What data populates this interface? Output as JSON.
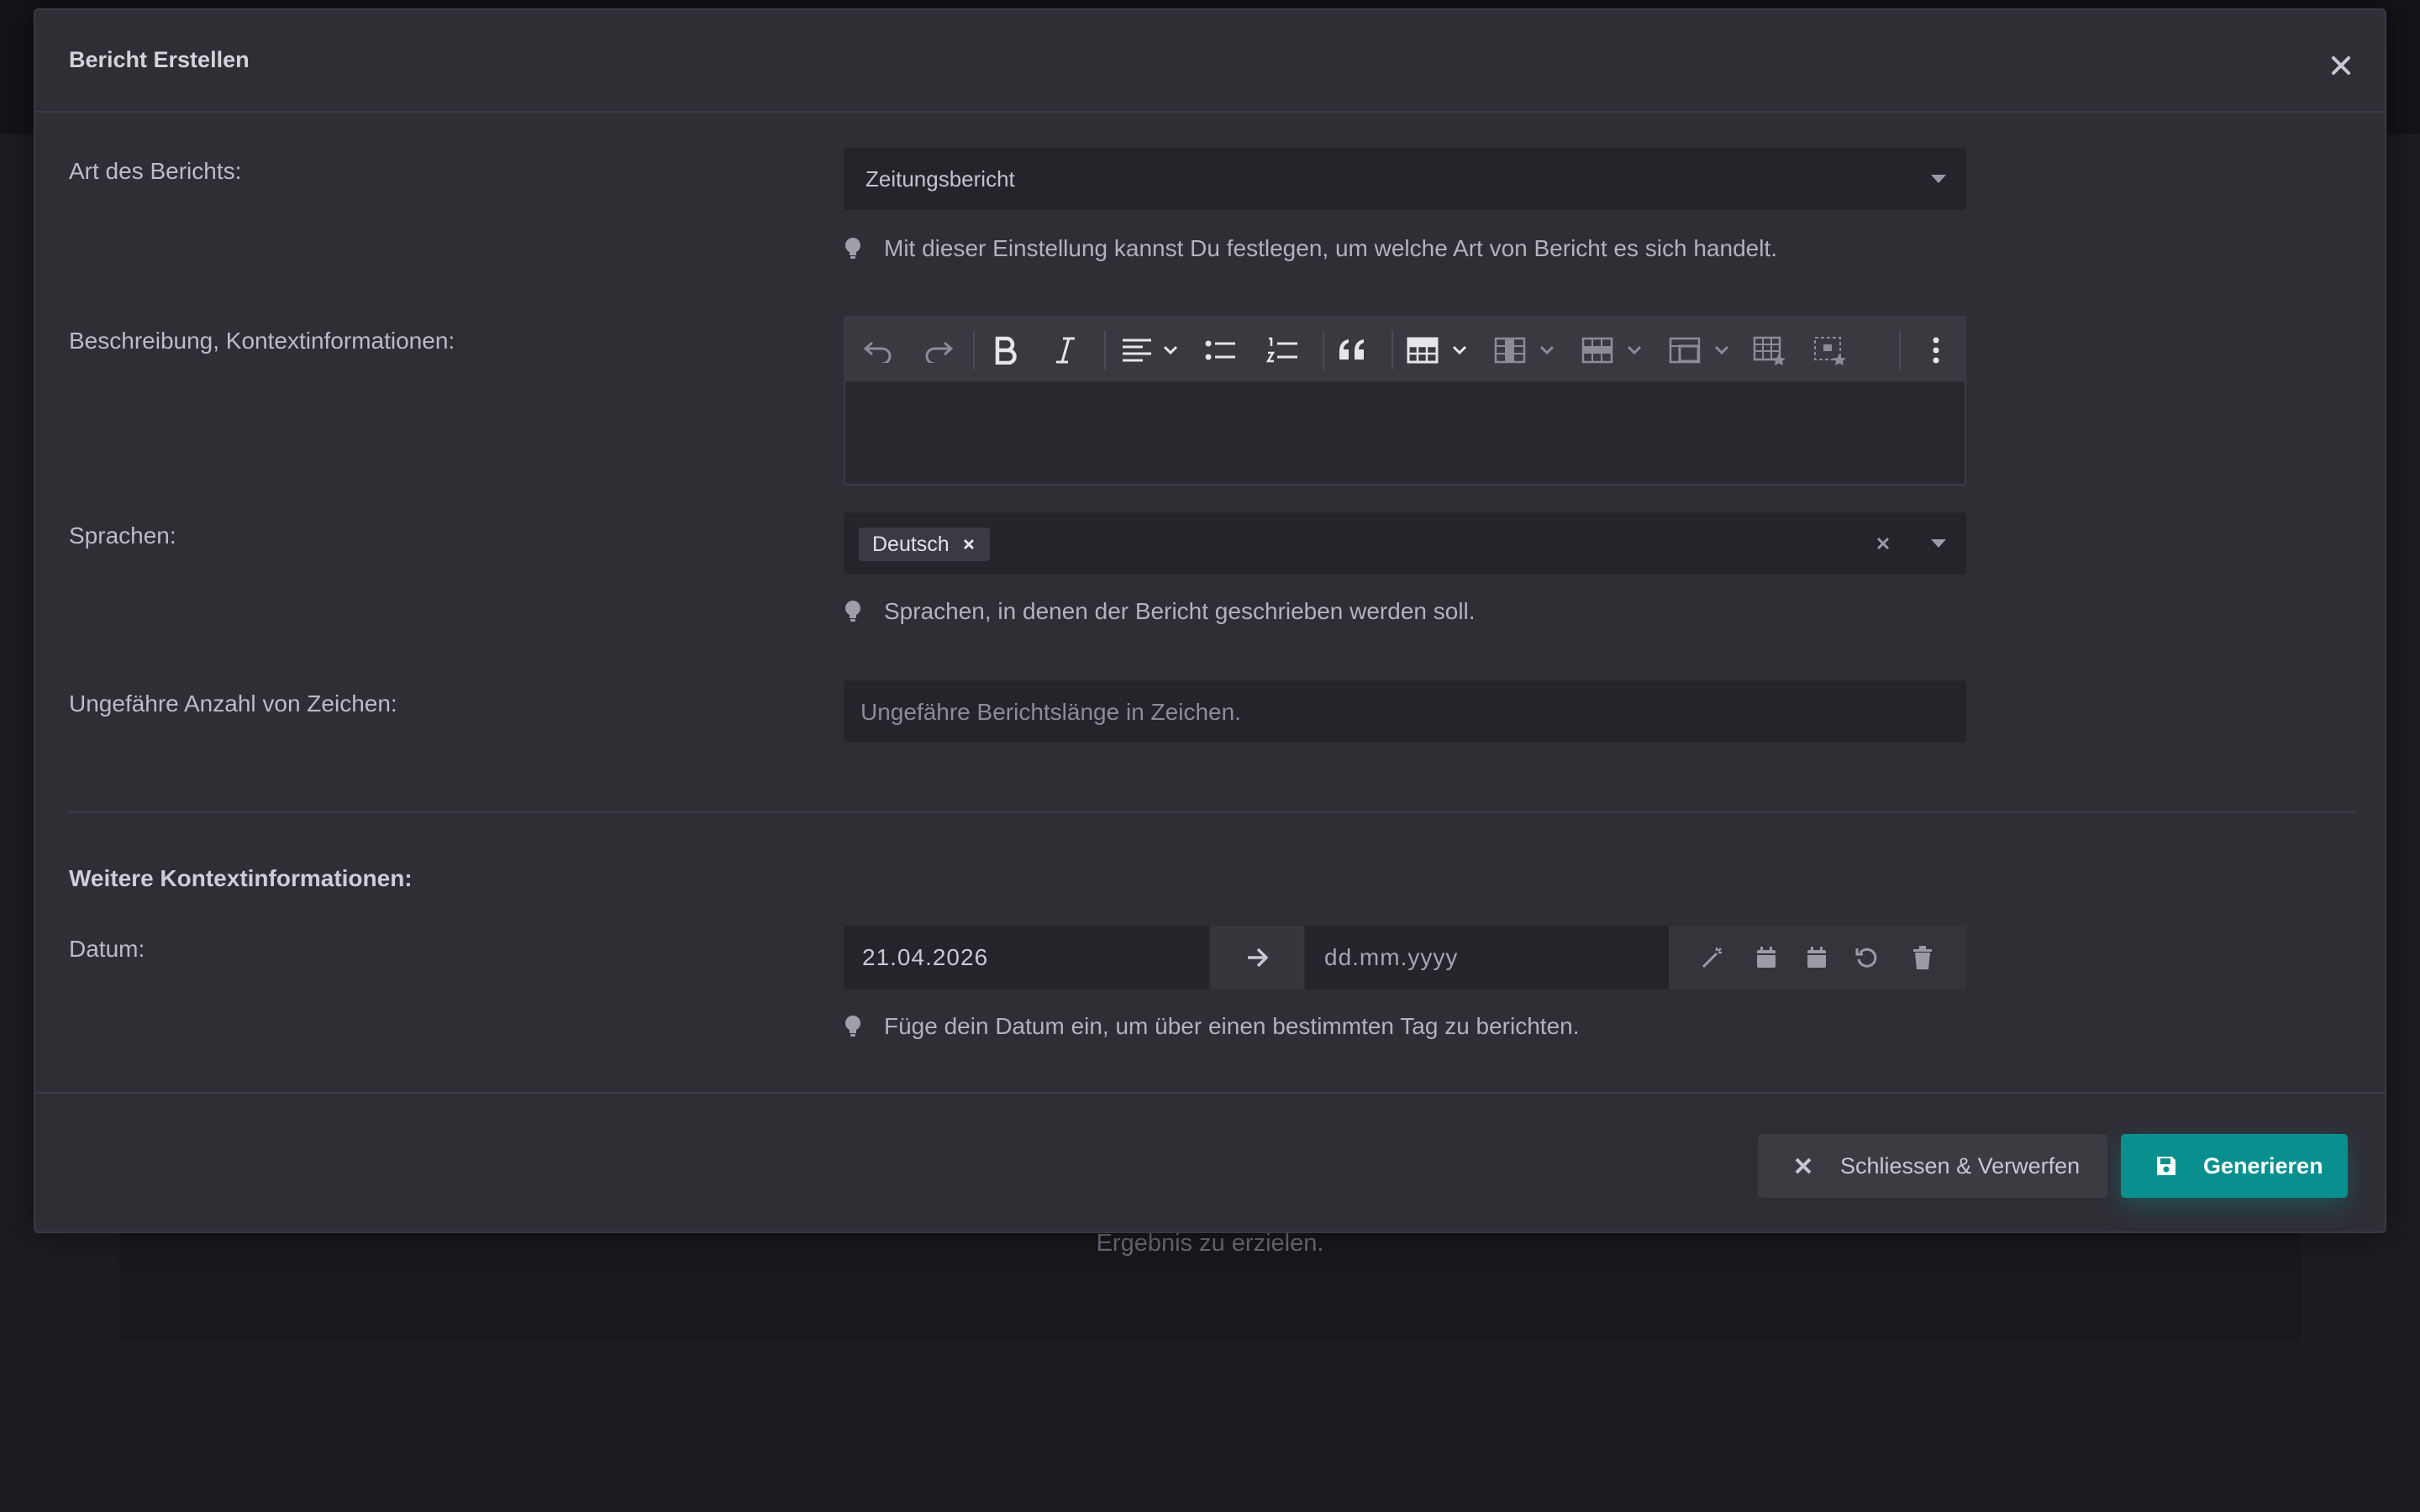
{
  "background": {
    "card_text": "Ergebnis zu erzielen."
  },
  "modal": {
    "title": "Bericht Erstellen"
  },
  "form": {
    "report_type": {
      "label": "Art des Berichts:",
      "value": "Zeitungsbericht",
      "hint": "Mit dieser Einstellung kannst Du festlegen, um welche Art von Bericht es sich handelt."
    },
    "description": {
      "label": "Beschreibung, Kontextinformationen:",
      "toolbar_icons": [
        "undo-icon",
        "redo-icon",
        "bold-icon",
        "italic-icon",
        "align-icon",
        "bullet-list-icon",
        "numbered-list-icon",
        "quote-icon",
        "table-icon",
        "table-column-icon",
        "table-row-icon",
        "table-cell-icon",
        "table-properties-icon",
        "table-cell-properties-icon",
        "more-vertical-icon"
      ]
    },
    "languages": {
      "label": "Sprachen:",
      "tags": [
        "Deutsch"
      ],
      "hint": "Sprachen, in denen der Bericht geschrieben werden soll."
    },
    "char_count": {
      "label": "Ungefähre Anzahl von Zeichen:",
      "placeholder": "Ungefähre Berichtslänge in Zeichen."
    },
    "section_title": "Weitere Kontextinformationen:",
    "date": {
      "label": "Datum:",
      "from_value": "21.04.2026",
      "to_placeholder": "dd.mm.yyyy",
      "hint": "Füge dein Datum ein, um über einen bestimmten Tag zu berichten."
    }
  },
  "footer": {
    "close_label": "Schliessen & Verwerfen",
    "generate_label": "Generieren"
  },
  "colors": {
    "accent": "#0a8f8f",
    "modal_bg": "#2f2e35",
    "page_bg": "#1d1c22"
  }
}
